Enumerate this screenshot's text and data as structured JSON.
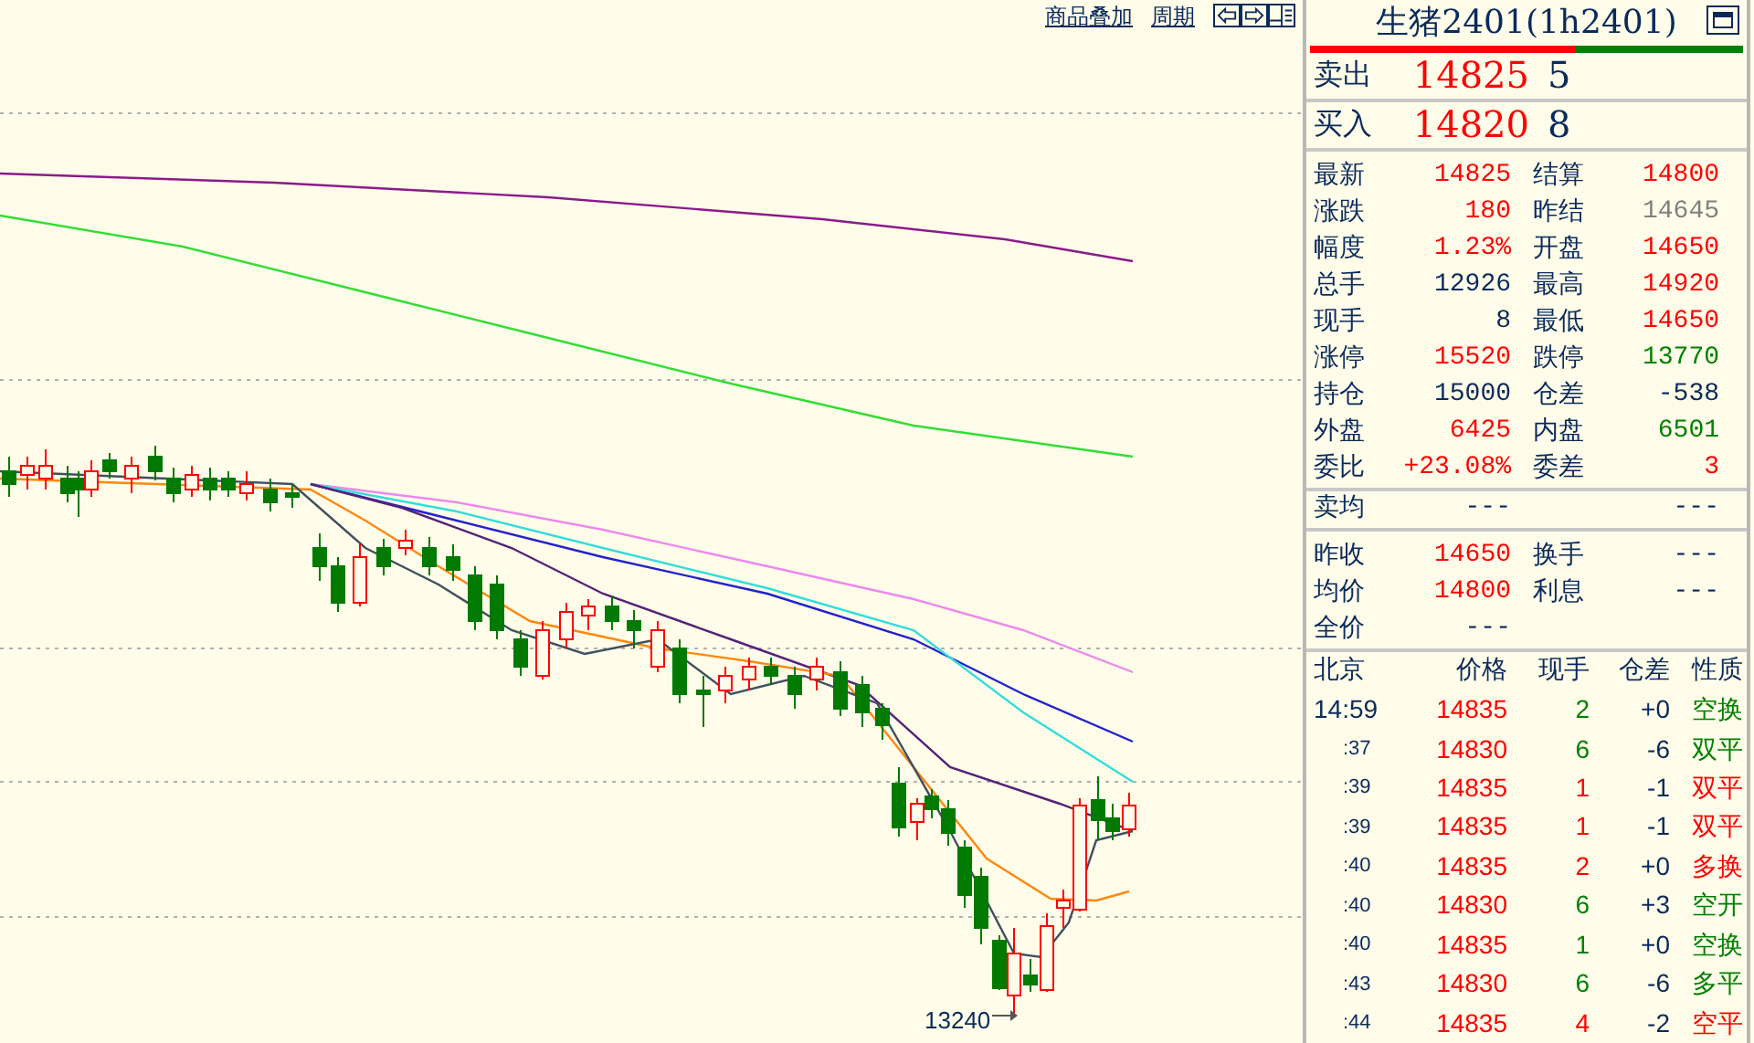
{
  "toolbar": {
    "links": [
      "商品叠加",
      "周期"
    ]
  },
  "chart": {
    "low_label": "13240"
  },
  "quote_panel": {
    "title": "生猪2401(1h2401)",
    "ratio_bar": {
      "level": 0.61
    },
    "best": [
      {
        "label": "卖出",
        "price": "14825",
        "volume": "5"
      },
      {
        "label": "买入",
        "price": "14820",
        "volume": "8"
      }
    ],
    "stats": [
      [
        {
          "label": "最新",
          "value": "14825",
          "color": "#ff0000"
        },
        {
          "label": "结算",
          "value": "14800",
          "color": "#ff0000"
        }
      ],
      [
        {
          "label": "涨跌",
          "value": "180",
          "color": "#ff0000"
        },
        {
          "label": "昨结",
          "value": "14645",
          "color": "#808080"
        }
      ],
      [
        {
          "label": "幅度",
          "value": "1.23%",
          "color": "#ff0000"
        },
        {
          "label": "开盘",
          "value": "14650",
          "color": "#ff0000"
        }
      ],
      [
        {
          "label": "总手",
          "value": "12926",
          "color": "#0a2a5c"
        },
        {
          "label": "最高",
          "value": "14920",
          "color": "#ff0000"
        }
      ],
      [
        {
          "label": "现手",
          "value": "8",
          "color": "#0a2a5c"
        },
        {
          "label": "最低",
          "value": "14650",
          "color": "#ff0000"
        }
      ],
      [
        {
          "label": "涨停",
          "value": "15520",
          "color": "#ff0000"
        },
        {
          "label": "跌停",
          "value": "13770",
          "color": "#008000"
        }
      ],
      [
        {
          "label": "持仓",
          "value": "15000",
          "color": "#0a2a5c"
        },
        {
          "label": "仓差",
          "value": "-538",
          "color": "#0a2a5c"
        }
      ],
      [
        {
          "label": "外盘",
          "value": "6425",
          "color": "#ff0000"
        },
        {
          "label": "内盘",
          "value": "6501",
          "color": "#008000"
        }
      ],
      [
        {
          "label": "委比",
          "value": "+23.08%",
          "color": "#ff0000"
        },
        {
          "label": "委差",
          "value": "3",
          "color": "#ff0000"
        }
      ]
    ],
    "avg_sell": {
      "label": "卖均",
      "value": "---",
      "value_2": "---"
    },
    "extra": [
      [
        {
          "label": "昨收",
          "value": "14650",
          "color": "#ff0000"
        },
        {
          "label": "换手",
          "value": "---",
          "color": "#0a2a5c"
        }
      ],
      [
        {
          "label": "均价",
          "value": "14800",
          "color": "#ff0000"
        },
        {
          "label": "利息",
          "value": "---",
          "color": "#0a2a5c"
        }
      ],
      [
        {
          "label": "全价",
          "value": "---",
          "color": "#0a2a5c"
        }
      ]
    ],
    "ticks": {
      "columns": [
        "北京",
        "价格",
        "现手",
        "仓差",
        "性质"
      ],
      "rows": [
        {
          "time": "14:59",
          "price": "14835",
          "volume": "2",
          "change": "+0",
          "nature": "空换",
          "color": "#008000"
        },
        {
          "time": ":37",
          "price": "14830",
          "volume": "6",
          "change": "-6",
          "nature": "双平",
          "color": "#008000"
        },
        {
          "time": ":39",
          "price": "14835",
          "volume": "1",
          "change": "-1",
          "nature": "双平",
          "color": "#ff0000"
        },
        {
          "time": ":39",
          "price": "14835",
          "volume": "1",
          "change": "-1",
          "nature": "双平",
          "color": "#ff0000"
        },
        {
          "time": ":40",
          "price": "14835",
          "volume": "2",
          "change": "+0",
          "nature": "多换",
          "color": "#ff0000"
        },
        {
          "time": ":40",
          "price": "14830",
          "volume": "6",
          "change": "+3",
          "nature": "空开",
          "color": "#008000"
        },
        {
          "time": ":40",
          "price": "14835",
          "volume": "1",
          "change": "+0",
          "nature": "空换",
          "color": "#008000"
        },
        {
          "time": ":43",
          "price": "14830",
          "volume": "6",
          "change": "-6",
          "nature": "多平",
          "color": "#008000"
        },
        {
          "time": ":44",
          "price": "14835",
          "volume": "4",
          "change": "-2",
          "nature": "空平",
          "color": "#ff0000"
        }
      ]
    }
  }
}
